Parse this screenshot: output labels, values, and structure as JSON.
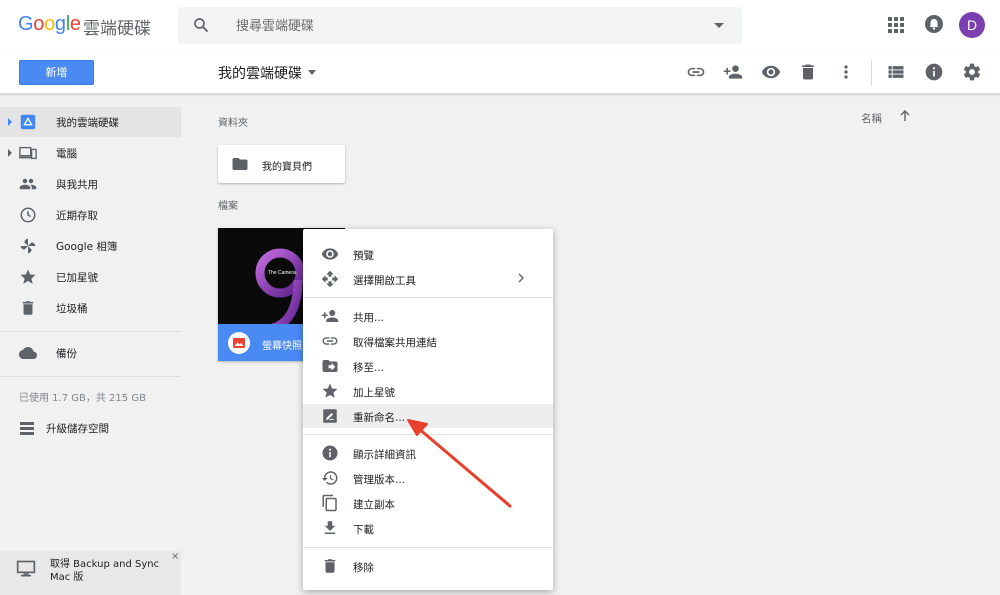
{
  "header": {
    "logo": "Google",
    "product": "雲端硬碟",
    "search_placeholder": "搜尋雲端硬碟",
    "avatar_letter": "D"
  },
  "toolbar": {
    "new_label": "新增",
    "breadcrumb": "我的雲端硬碟"
  },
  "sidebar": {
    "items": [
      {
        "label": "我的雲端硬碟",
        "icon": "drive-icon"
      },
      {
        "label": "電腦",
        "icon": "computers-icon"
      },
      {
        "label": "與我共用",
        "icon": "shared-icon"
      },
      {
        "label": "近期存取",
        "icon": "recent-icon"
      },
      {
        "label": "Google 相簿",
        "icon": "photos-icon"
      },
      {
        "label": "已加星號",
        "icon": "star-icon"
      },
      {
        "label": "垃圾桶",
        "icon": "trash-icon"
      },
      {
        "label": "備份",
        "icon": "cloud-icon"
      }
    ],
    "storage": "已使用 1.7 GB，共 215 GB",
    "upgrade": "升級儲存空間",
    "backup": "取得 Backup and Sync Mac 版",
    "backup_close": "×"
  },
  "main": {
    "folders_label": "資料夾",
    "files_label": "檔案",
    "sort_label": "名稱",
    "folder_name": "我的寶貝們",
    "file_name": "螢幕快照",
    "thumb_text": "The Camera."
  },
  "context_menu": {
    "items": [
      {
        "label": "預覽",
        "icon": "eye-icon"
      },
      {
        "label": "選擇開啟工具",
        "icon": "move-arrows-icon",
        "submenu": true
      },
      {
        "label": "共用...",
        "icon": "person-add-icon"
      },
      {
        "label": "取得檔案共用連結",
        "icon": "link-icon"
      },
      {
        "label": "移至...",
        "icon": "folder-move-icon"
      },
      {
        "label": "加上星號",
        "icon": "star-icon"
      },
      {
        "label": "重新命名...",
        "icon": "rename-icon",
        "highlighted": true
      },
      {
        "label": "顯示詳細資訊",
        "icon": "info-icon"
      },
      {
        "label": "管理版本...",
        "icon": "history-icon"
      },
      {
        "label": "建立副本",
        "icon": "copy-icon"
      },
      {
        "label": "下載",
        "icon": "download-icon"
      },
      {
        "label": "移除",
        "icon": "trash-icon"
      }
    ]
  },
  "colors": {
    "accent": "#4a8af4",
    "avatar": "#7b3fb0",
    "annotation_arrow": "#e8402b"
  }
}
